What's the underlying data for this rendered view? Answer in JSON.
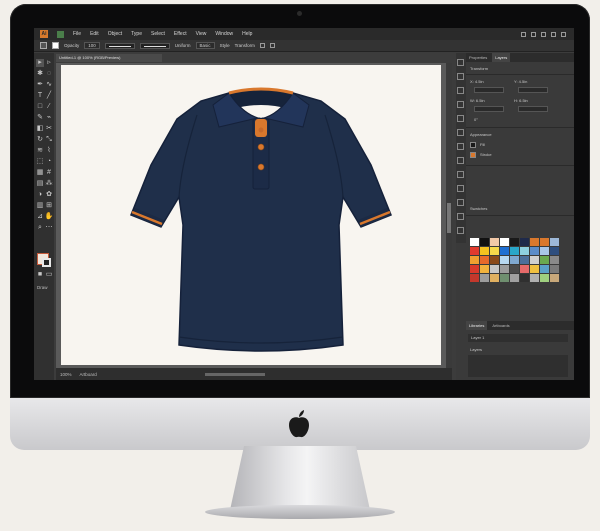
{
  "menubar": {
    "logo": "Ai",
    "items": [
      "File",
      "Edit",
      "Object",
      "Type",
      "Select",
      "Effect",
      "View",
      "Window",
      "Help"
    ]
  },
  "options_bar": {
    "opacity_label": "Opacity",
    "uniform_label": "Uniform",
    "basic_label": "Basic",
    "style_label": "Style",
    "transform_label": "Transform"
  },
  "document": {
    "tab_title": "Untitled-1 @ 100% (RGB/Preview)",
    "zoom": "100%",
    "artboard_nav": "Artboard"
  },
  "tools": {
    "caption": "Draw"
  },
  "panels": {
    "tab_properties": "Properties",
    "tab_layers": "Layers",
    "section_transform": "Transform",
    "label_x": "X: 4.5in",
    "label_y": "Y: 4.5in",
    "label_w": "W: 6.5in",
    "label_h": "H: 6.5in",
    "rotate": "0°",
    "section_appearance": "Appearance",
    "fill_label": "Fill",
    "stroke_label": "Stroke",
    "section_swatches": "Swatches",
    "tab_libraries": "Libraries",
    "tab_artboards": "Artboards",
    "layer_name": "Layer 1",
    "section_layers": "Layers"
  },
  "swatches": [
    "#ffffff",
    "#111111",
    "#f2c9a8",
    "#ffffff",
    "#1a1a1a",
    "#1f2a4a",
    "#d9782d",
    "#d9782d",
    "#9db8d8",
    "#e23b2e",
    "#f4c21f",
    "#f6d84a",
    "#1f6fd1",
    "#2aa7c9",
    "#8fd0df",
    "#5b8cc9",
    "#a8c6e8",
    "#2e4e7e",
    "#f0a030",
    "#e86a2a",
    "#8a4a1a",
    "#b8d8f0",
    "#7fa8d0",
    "#4d6f9a",
    "#d0d0d0",
    "#6aa84f",
    "#8a8a8a",
    "#d93a2b",
    "#f2b33d",
    "#c7c7c7",
    "#9c9c9c",
    "#4a4a4a",
    "#e66a6a",
    "#f0c040",
    "#5aa0c8",
    "#7a7a7a",
    "#c3382c",
    "#9c9c9c",
    "#e0b060",
    "#6f8f6f",
    "#a0a0a0",
    "#303030",
    "#b0b0b0",
    "#9fcf7f",
    "#c8a87a"
  ],
  "colors": {
    "shirt": "#1f2f4a",
    "trim": "#d9782d",
    "artboard": "#f8f5f0"
  }
}
